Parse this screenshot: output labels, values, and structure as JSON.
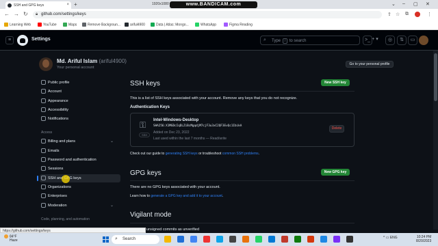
{
  "browser": {
    "tab_title": "SSH and GPG keys",
    "tab_close": "×",
    "new_tab": "+",
    "recording_overlay": "www.BANDICAM.com",
    "resolution": "1920x1080",
    "window_controls": [
      "⌄",
      "–",
      "▢",
      "✕"
    ],
    "url": "github.com/settings/keys",
    "nav": [
      "←",
      "→",
      "↻"
    ],
    "bookmarks": [
      {
        "label": "Learning Web",
        "color": "#e6a700"
      },
      {
        "label": "YouTube",
        "color": "#ff0000"
      },
      {
        "label": "Maps",
        "color": "#34a853"
      },
      {
        "label": "Remove Backgroun...",
        "color": "#5f6368"
      },
      {
        "label": "ariful4900",
        "color": "#24292f"
      },
      {
        "label": "Data | Atlas: Mongo...",
        "color": "#13aa52"
      },
      {
        "label": "WhatsApp",
        "color": "#25d366"
      },
      {
        "label": "Figma Reading",
        "color": "#a259ff"
      }
    ]
  },
  "header": {
    "menu_icon": "≡",
    "title": "Settings",
    "search_placeholder_prefix": "Type",
    "search_key": "/",
    "search_placeholder_suffix": "to search",
    "search_icon": "⌕",
    "terminal_icon": ">_",
    "plus_icon": "+ ▾",
    "issues_icon": "◎",
    "pr_icon": "⇅",
    "inbox_icon": "▭"
  },
  "profile": {
    "name": "Md. Ariful Islam",
    "handle": "(ariful4900)",
    "subtitle": "Your personal account",
    "go_to_profile": "Go to your personal profile"
  },
  "sidebar": {
    "items": [
      {
        "label": "Public profile",
        "active": false,
        "expandable": false
      },
      {
        "label": "Account",
        "active": false,
        "expandable": false
      },
      {
        "label": "Appearance",
        "active": false,
        "expandable": false
      },
      {
        "label": "Accessibility",
        "active": false,
        "expandable": false
      },
      {
        "label": "Notifications",
        "active": false,
        "expandable": false
      }
    ],
    "section_access": "Access",
    "access_items": [
      {
        "label": "Billing and plans",
        "expandable": true,
        "chevron": "⌄"
      },
      {
        "label": "Emails",
        "expandable": false
      },
      {
        "label": "Password and authentication",
        "expandable": false
      },
      {
        "label": "Sessions",
        "expandable": false
      },
      {
        "label": "SSH and GPG keys",
        "expandable": false,
        "active": true
      },
      {
        "label": "Organizations",
        "expandable": false
      },
      {
        "label": "Enterprises",
        "expandable": false
      },
      {
        "label": "Moderation",
        "expandable": true,
        "chevron": "⌄"
      }
    ],
    "section_code": "Code, planning, and automation"
  },
  "ssh": {
    "title": "SSH keys",
    "new_button": "New SSH key",
    "description": "This is a list of SSH keys associated with your account. Remove any keys that you do not recognize.",
    "subheading": "Authentication Keys",
    "key": {
      "title": "Intel-Windows-Desktop",
      "fingerprint": "SHA256:X1MGDcIqDLZiBcMgqdjM7cjF3u3xC2QF3EvQc1IbikA",
      "added": "Added on Dec 23, 2022",
      "last_used": "Last used within the last 7 months — Read/write",
      "badge": "SSH",
      "delete": "Delete"
    },
    "guide_prefix": "Check out our guide to",
    "guide_link": "generating SSH keys",
    "guide_middle": "or troubleshoot",
    "guide_link2": "common SSH problems",
    "guide_suffix": "."
  },
  "gpg": {
    "title": "GPG keys",
    "new_button": "New GPG key",
    "empty": "There are no GPG keys associated with your account.",
    "learn_prefix": "Learn how to",
    "learn_link": "generate a GPG key and add it to your account",
    "learn_suffix": "."
  },
  "vigilant": {
    "title": "Vigilant mode",
    "partial": "unsigned commits as unverified"
  },
  "status_tooltip": "https://github.com/settings/keys",
  "taskbar": {
    "temperature": "84°F",
    "condition": "Haze",
    "search_label": "Search",
    "search_icon": "⌕",
    "tray": "^  ▭  ENG",
    "time": "10:24 PM",
    "date": "8/20/2023",
    "app_colors": [
      "#f5b800",
      "#1f6fd6",
      "#4285f4",
      "#e33",
      "#0ea5e9",
      "#444",
      "#e8720c",
      "#25d366",
      "#0078d4",
      "#c0392b",
      "#0e7a0d",
      "#d4380d",
      "#1e88e5",
      "#7b2ff7",
      "#333"
    ]
  }
}
